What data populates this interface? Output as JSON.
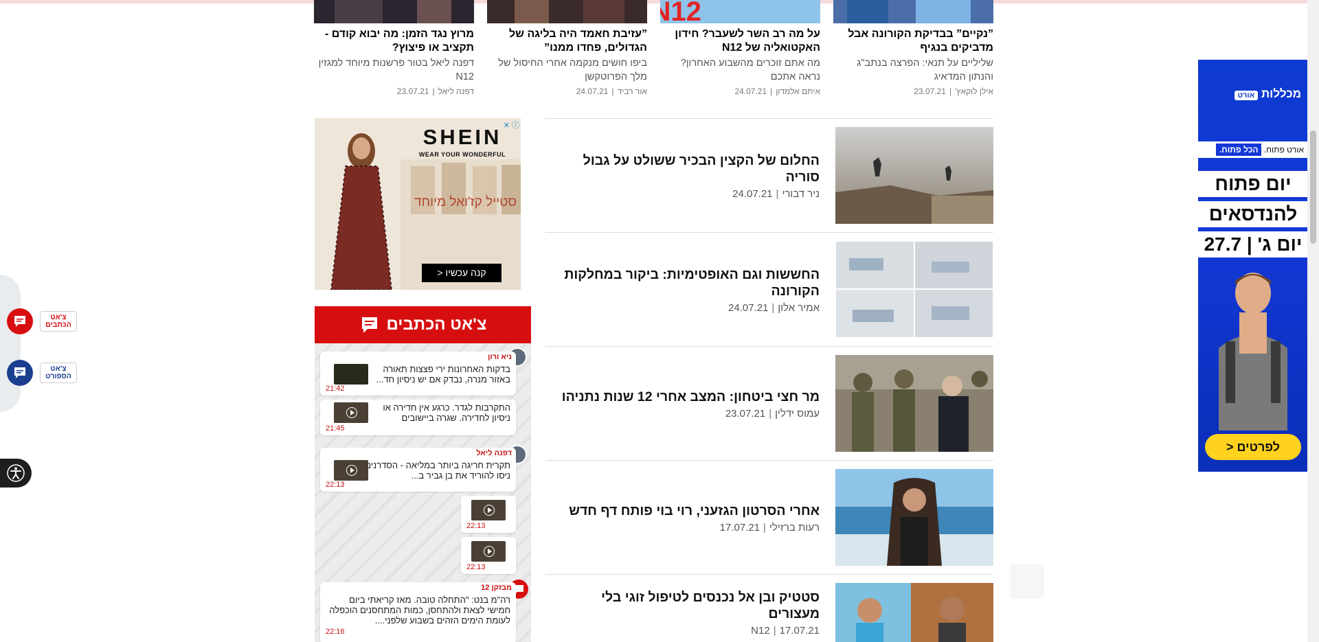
{
  "top_articles": [
    {
      "title": "”נקיים” בבדיקת הקורונה אבל מדביקים בנגיף",
      "subtitle": "שליליים על תנאי: הפרצה בנתב\"ג והנתון המדאיג",
      "author": "אילן לוקאץ'",
      "date": "23.07.21"
    },
    {
      "title": "על מה רב השר לשעבר? חידון האקטואליה של N12",
      "subtitle": "מה אתם זוכרים מהשבוע האחרון? נראה אתכם",
      "author": "איתם אלמדון",
      "date": "24.07.21"
    },
    {
      "title": "”עזיבת חאמד היה בליגה של הגדולים, פחדו ממנו”",
      "subtitle": "ביפו חושים מנקמה אחרי החיסול של מלך הפרוטקשן",
      "author": "אור רביד",
      "date": "24.07.21"
    },
    {
      "title": "מרוץ נגד הזמן: מה יבוא קודם - תקציב או פיצוץ?",
      "subtitle": "דפנה ליאל בטור פרשנות מיוחד למגזין N12",
      "author": "דפנה ליאל",
      "date": "23.07.21"
    }
  ],
  "main_articles": [
    {
      "title": "החלום של הקצין הבכיר ששולט על גבול סוריה",
      "author": "ניר דבורי",
      "date": "24.07.21"
    },
    {
      "title": "החששות וגם האופטימיות: ביקור במחלקות הקורונה",
      "author": "אמיר אלון",
      "date": "24.07.21"
    },
    {
      "title": "מר חצי ביטחון: המצב אחרי 12 שנות נתניהו",
      "author": "עמוס ידלין",
      "date": "23.07.21"
    },
    {
      "title": "אחרי הסרטון הגזעני, רוי בוי פותח דף חדש",
      "author": "רעות ברזילי",
      "date": "17.07.21"
    },
    {
      "title": "סטטיק ובן אל נכנסים לטיפול זוגי בלי מעצורים",
      "author": "N12",
      "date": "17.07.21"
    }
  ],
  "shein_ad": {
    "brand": "SHEIN",
    "tagline": "WEAR YOUR WONDERFUL",
    "headline": "סטייל קז'ואל מיוחד",
    "cta": "קנה עכשיו <"
  },
  "chat": {
    "title": "צ'אט הכתבים",
    "messages": [
      {
        "author": "ניא ורון",
        "text": "בדקות האחרונות ירי פצצות תאורה באזור מנרה, נבדק אם יש ניסיון חד...",
        "time": "21:42"
      },
      {
        "author": "",
        "text": "התקרבות לגדר. כרגע אין חדירה או ניסיון לחדירה. שגרה ביישובים",
        "time": "21:45"
      },
      {
        "author": "דפנה ליאל",
        "text": "תקרית חריגה ביותר במליאה - הסדרנים ניסו להוריד את בן גביר ב...",
        "time": "22:13"
      },
      {
        "author": "",
        "text": "",
        "time": "22:13"
      },
      {
        "author": "",
        "text": "",
        "time": "22:13"
      },
      {
        "author": "מבזקן 12",
        "text": "רה\"מ בנט: \"התחלה טובה. מאז קריאתי ביום חמישי לצאת ולהתחסן, כמות המתחסנים הוכפלה לעומת הימים הזהים בשבוע שלפני....",
        "time": "22:16"
      }
    ]
  },
  "float_buttons": [
    {
      "label": "צ'אט הכתבים",
      "color": "#d70e0f"
    },
    {
      "label": "צ'אט הספורט",
      "color": "#1b3f8f"
    }
  ],
  "ort_ad": {
    "brand": "מכללות",
    "brand_badge": "אורט",
    "strip_highlight": "הכל פתוח.",
    "strip_text": "אורט פתוח.",
    "line1": "יום פתוח",
    "line2": "להנדסאים",
    "line3": "יום ג' | 27.7",
    "cta": "לפרטים <"
  },
  "colors": {
    "chat_red": "#d70e0f",
    "sport_blue": "#1b3f8f",
    "ad_blue": "#1438d8",
    "ad_yellow": "#ffd21e"
  }
}
